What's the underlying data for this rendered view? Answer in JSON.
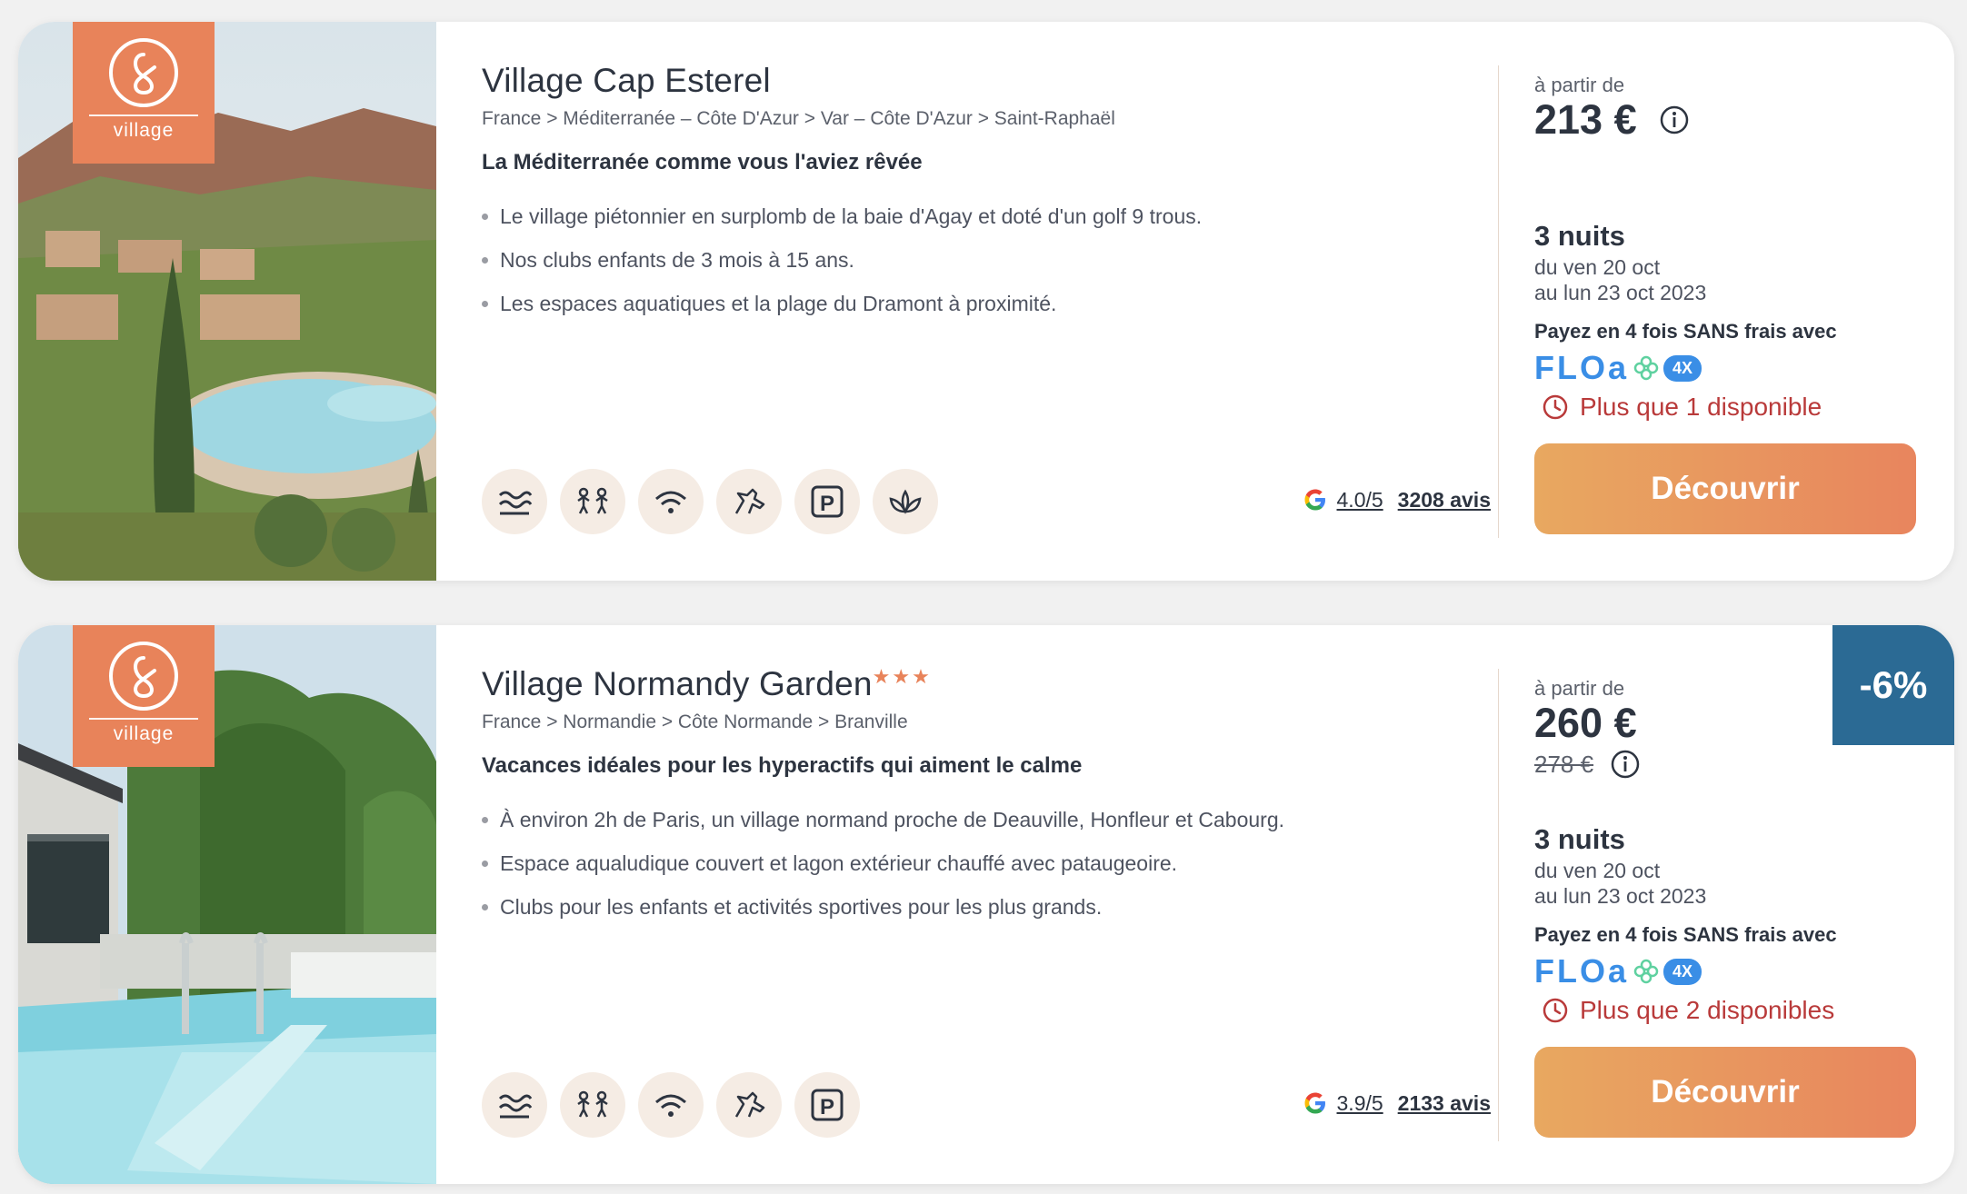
{
  "colors": {
    "accent": "#e8835a",
    "stock": "#b93a3a",
    "floa_blue": "#3a8ee6",
    "discount_bg": "#2b6a94"
  },
  "cards": [
    {
      "badge": "village",
      "title": "Village Cap Esterel",
      "stars": "",
      "breadcrumb": "France > Méditerranée – Côte D'Azur > Var – Côte D'Azur > Saint-Raphaël",
      "tagline": "La Méditerranée comme vous l'aviez rêvée",
      "features": [
        "Le village piétonnier en surplomb de la baie d'Agay et doté d'un golf 9 trous.",
        "Nos clubs enfants de 3 mois à 15 ans.",
        "Les espaces aquatiques et la plage du Dramont à proximité."
      ],
      "amenity_icons": [
        "water-waves-icon",
        "kids-club-icon",
        "wifi-icon",
        "horse-riding-icon",
        "parking-icon",
        "spa-lotus-icon"
      ],
      "parking_letter": "P",
      "rating_score": "4.0/5",
      "rating_count": "3208 avis",
      "from_label": "à partir de",
      "price": "213 €",
      "old_price": "",
      "nights": "3 nuits",
      "date_from": "du ven 20 oct",
      "date_to": "au lun 23 oct 2023",
      "pay_label": "Payez en 4 fois SANS frais avec",
      "floa_word": "FLOa",
      "floa_tag": "4X",
      "availability": "Plus que 1 disponible",
      "cta": "Découvrir",
      "discount": ""
    },
    {
      "badge": "village",
      "title": "Village Normandy Garden",
      "stars": "★★★",
      "breadcrumb": "France > Normandie > Côte Normande > Branville",
      "tagline": "Vacances idéales pour les hyperactifs qui aiment le calme",
      "features": [
        "À environ 2h de Paris, un village normand proche de Deauville, Honfleur et Cabourg.",
        "Espace aqualudique couvert et lagon extérieur chauffé avec pataugeoire.",
        "Clubs pour les enfants et activités sportives pour les plus grands."
      ],
      "amenity_icons": [
        "water-waves-icon",
        "kids-club-icon",
        "wifi-icon",
        "horse-riding-icon",
        "parking-icon"
      ],
      "parking_letter": "P",
      "rating_score": "3.9/5",
      "rating_count": "2133 avis",
      "from_label": "à partir de",
      "price": "260 €",
      "old_price": "278 €",
      "nights": "3 nuits",
      "date_from": "du ven 20 oct",
      "date_to": "au lun 23 oct 2023",
      "pay_label": "Payez en 4 fois SANS frais avec",
      "floa_word": "FLOa",
      "floa_tag": "4X",
      "availability": "Plus que 2 disponibles",
      "cta": "Découvrir",
      "discount": "-6%"
    }
  ]
}
